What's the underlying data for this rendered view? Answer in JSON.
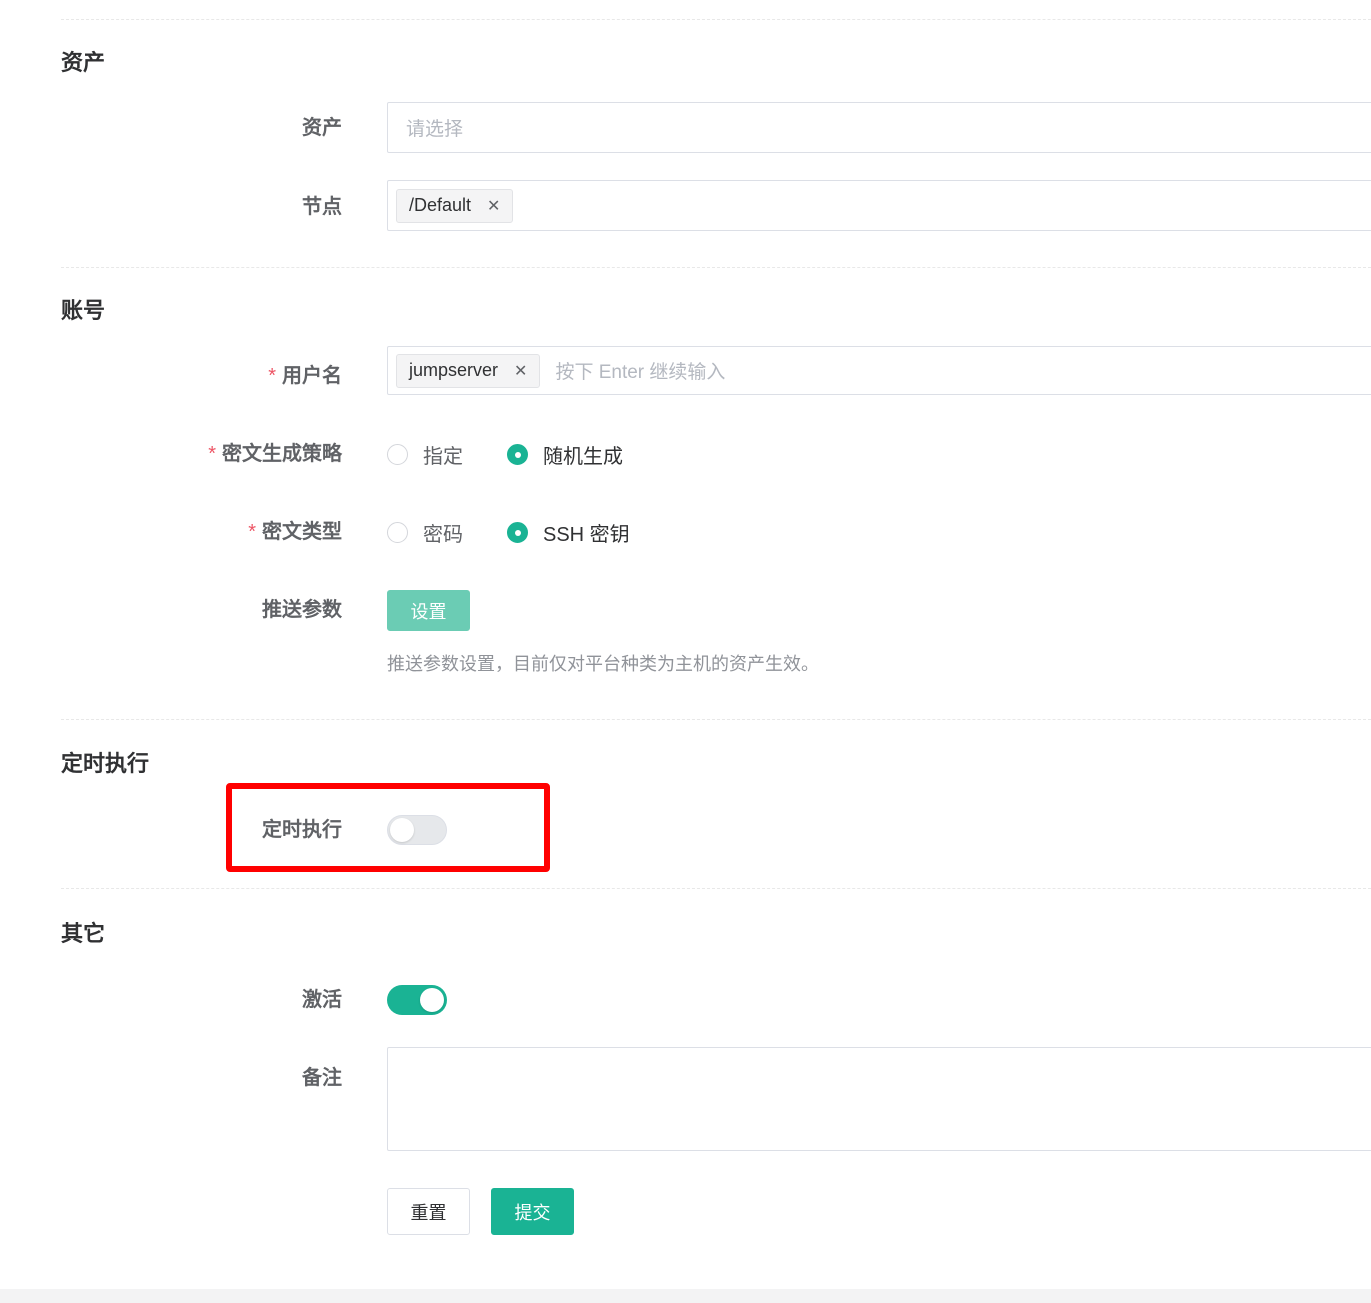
{
  "sections": {
    "asset": {
      "title": "资产"
    },
    "account": {
      "title": "账号"
    },
    "schedule": {
      "title": "定时执行"
    },
    "other": {
      "title": "其它"
    }
  },
  "fields": {
    "asset": {
      "label": "资产",
      "placeholder": "请选择"
    },
    "node": {
      "label": "节点",
      "tag": "/Default"
    },
    "username": {
      "label": "用户名",
      "required_mark": "*",
      "tag": "jumpserver",
      "placeholder": "按下 Enter 继续输入"
    },
    "secret_strategy": {
      "label": "密文生成策略",
      "required_mark": "*",
      "options": [
        "指定",
        "随机生成"
      ],
      "selected": "随机生成"
    },
    "secret_type": {
      "label": "密文类型",
      "required_mark": "*",
      "options": [
        "密码",
        "SSH 密钥"
      ],
      "selected": "SSH 密钥"
    },
    "push_params": {
      "label": "推送参数",
      "button": "设置",
      "help": "推送参数设置，目前仅对平台种类为主机的资产生效。"
    },
    "schedule_enabled": {
      "label": "定时执行",
      "value": false
    },
    "is_active": {
      "label": "激活",
      "value": true
    },
    "comment": {
      "label": "备注",
      "value": ""
    }
  },
  "actions": {
    "reset": "重置",
    "submit": "提交"
  },
  "colors": {
    "primary": "#1ab394",
    "required": "#ed5565",
    "highlight": "#ff0000"
  },
  "icons": {
    "tag_close": "close-icon"
  }
}
